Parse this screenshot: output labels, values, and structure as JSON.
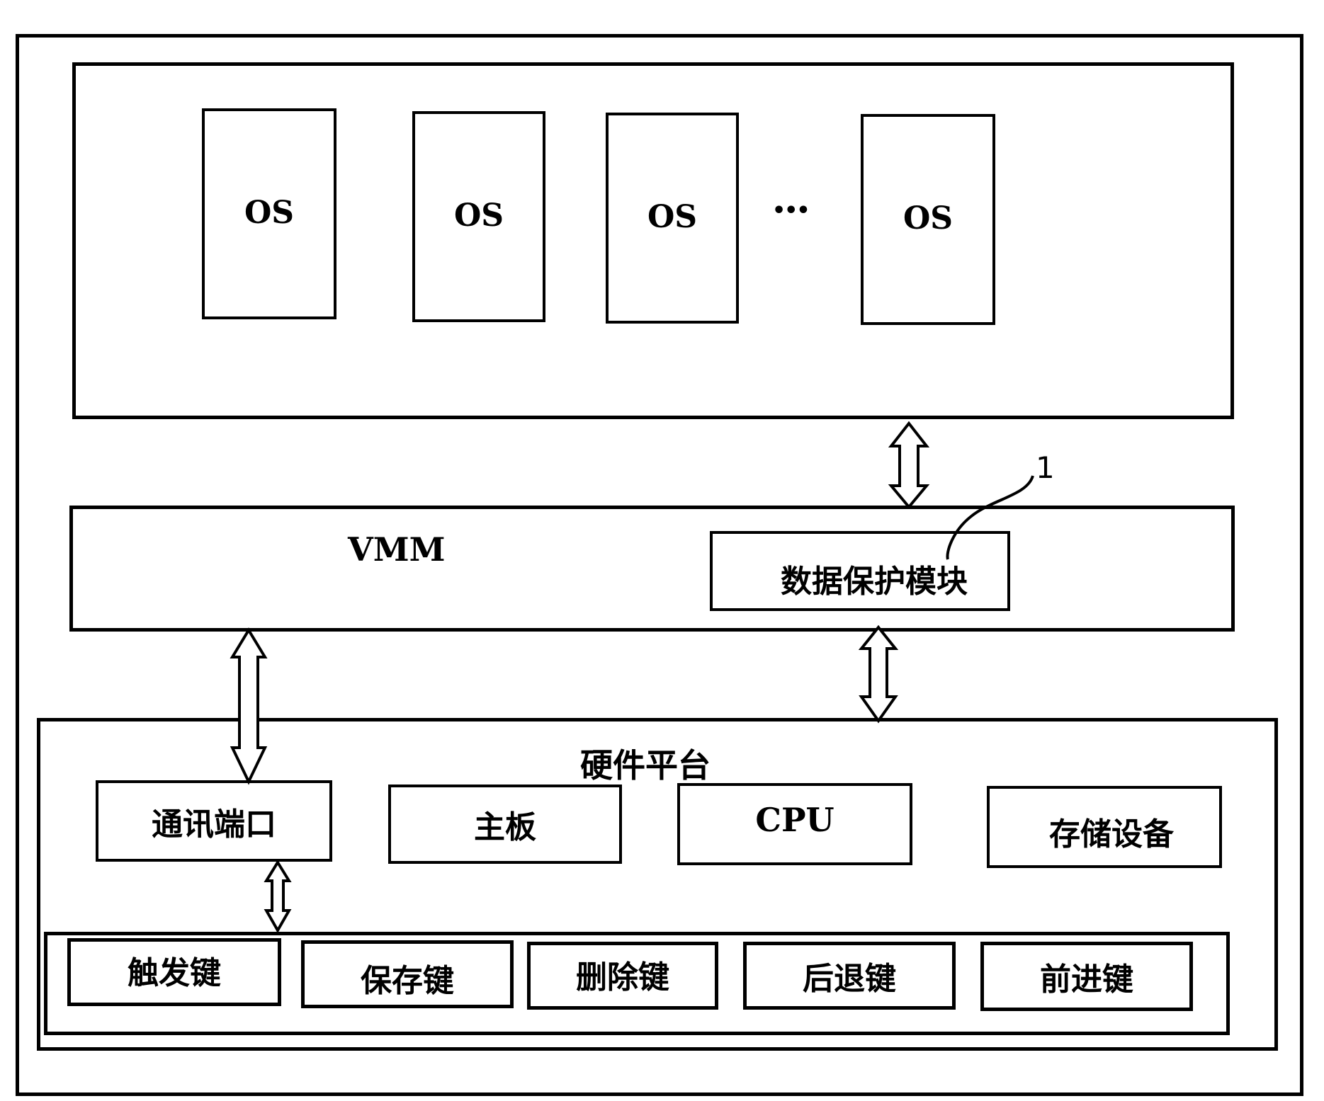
{
  "diagram": {
    "guest_layer": {
      "os_boxes": [
        {
          "label": "OS"
        },
        {
          "label": "OS"
        },
        {
          "label": "OS"
        },
        {
          "label": "OS"
        }
      ],
      "ellipsis": "•••"
    },
    "vmm_layer": {
      "label": "VMM",
      "data_protection_module": {
        "label": "数据保护模块"
      },
      "callout_number": "1"
    },
    "hardware_platform": {
      "label": "硬件平台",
      "components": [
        {
          "label": "通讯端口"
        },
        {
          "label": "主板"
        },
        {
          "label": "CPU"
        },
        {
          "label": "存储设备"
        }
      ],
      "keys": [
        {
          "label": "触发键"
        },
        {
          "label": "保存键"
        },
        {
          "label": "删除键"
        },
        {
          "label": "后退键"
        },
        {
          "label": "前进键"
        }
      ]
    }
  }
}
